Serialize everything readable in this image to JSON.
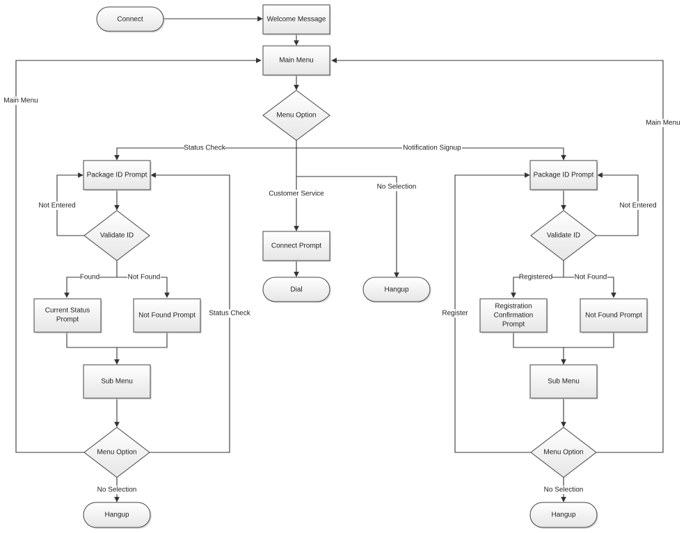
{
  "diagram": {
    "type": "flowchart",
    "colors": {
      "node_fill_top": "#ffffff",
      "node_fill_bottom": "#e8e8e8",
      "stroke": "#404040",
      "edge": "#333333",
      "text": "#222222"
    },
    "nodes": {
      "connect": {
        "label": "Connect",
        "shape": "terminator"
      },
      "welcome": {
        "label": "Welcome Message",
        "shape": "process"
      },
      "main_menu": {
        "label": "Main Menu",
        "shape": "process"
      },
      "menu_option": {
        "label": "Menu Option",
        "shape": "decision"
      },
      "connect_prompt": {
        "label": "Connect Prompt",
        "shape": "process"
      },
      "dial": {
        "label": "Dial",
        "shape": "terminator"
      },
      "hangup_center": {
        "label": "Hangup",
        "shape": "terminator"
      },
      "l_pkg_prompt": {
        "label": "Package ID Prompt",
        "shape": "process"
      },
      "l_validate": {
        "label": "Validate ID",
        "shape": "decision"
      },
      "l_current_status": {
        "label": [
          "Current Status",
          "Prompt"
        ],
        "shape": "process"
      },
      "l_not_found": {
        "label": "Not Found Prompt",
        "shape": "process"
      },
      "l_sub_menu": {
        "label": "Sub Menu",
        "shape": "process"
      },
      "l_menu_option": {
        "label": "Menu Option",
        "shape": "decision"
      },
      "l_hangup": {
        "label": "Hangup",
        "shape": "terminator"
      },
      "r_pkg_prompt": {
        "label": "Package ID Prompt",
        "shape": "process"
      },
      "r_validate": {
        "label": "Validate ID",
        "shape": "decision"
      },
      "r_reg_confirm": {
        "label": [
          "Registration",
          "Confirmation",
          "Prompt"
        ],
        "shape": "process"
      },
      "r_not_found": {
        "label": "Not Found Prompt",
        "shape": "process"
      },
      "r_sub_menu": {
        "label": "Sub Menu",
        "shape": "process"
      },
      "r_menu_option": {
        "label": "Menu Option",
        "shape": "decision"
      },
      "r_hangup": {
        "label": "Hangup",
        "shape": "terminator"
      }
    },
    "edge_labels": {
      "status_check": "Status Check",
      "notification_signup": "Notification Signup",
      "customer_service": "Customer Service",
      "no_selection_center": "No Selection",
      "left_main_menu": "Main Menu",
      "right_main_menu": "Main Menu",
      "l_not_entered": "Not Entered",
      "l_found": "Found",
      "l_not_found": "Not Found",
      "l_status_check_loop": "Status Check",
      "l_no_selection": "No Selection",
      "r_not_entered": "Not Entered",
      "r_registered": "Registered",
      "r_not_found": "Not Found",
      "r_register": "Register",
      "r_no_selection": "No Selection"
    },
    "edges": [
      [
        "connect",
        "welcome"
      ],
      [
        "welcome",
        "main_menu"
      ],
      [
        "main_menu",
        "menu_option"
      ],
      [
        "menu_option",
        "l_pkg_prompt",
        "Status Check"
      ],
      [
        "menu_option",
        "r_pkg_prompt",
        "Notification Signup"
      ],
      [
        "menu_option",
        "connect_prompt",
        "Customer Service"
      ],
      [
        "menu_option",
        "hangup_center",
        "No Selection"
      ],
      [
        "connect_prompt",
        "dial"
      ],
      [
        "l_pkg_prompt",
        "l_validate"
      ],
      [
        "l_validate",
        "l_pkg_prompt",
        "Not Entered"
      ],
      [
        "l_validate",
        "l_current_status",
        "Found"
      ],
      [
        "l_validate",
        "l_not_found",
        "Not Found"
      ],
      [
        "l_current_status",
        "l_sub_menu"
      ],
      [
        "l_not_found",
        "l_sub_menu"
      ],
      [
        "l_sub_menu",
        "l_menu_option"
      ],
      [
        "l_menu_option",
        "main_menu",
        "Main Menu"
      ],
      [
        "l_menu_option",
        "l_pkg_prompt",
        "Status Check"
      ],
      [
        "l_menu_option",
        "l_hangup",
        "No Selection"
      ],
      [
        "r_pkg_prompt",
        "r_validate"
      ],
      [
        "r_validate",
        "r_pkg_prompt",
        "Not Entered"
      ],
      [
        "r_validate",
        "r_reg_confirm",
        "Registered"
      ],
      [
        "r_validate",
        "r_not_found",
        "Not Found"
      ],
      [
        "r_reg_confirm",
        "r_sub_menu"
      ],
      [
        "r_not_found",
        "r_sub_menu"
      ],
      [
        "r_sub_menu",
        "r_menu_option"
      ],
      [
        "r_menu_option",
        "main_menu",
        "Main Menu"
      ],
      [
        "r_menu_option",
        "r_pkg_prompt",
        "Register"
      ],
      [
        "r_menu_option",
        "r_hangup",
        "No Selection"
      ]
    ]
  }
}
